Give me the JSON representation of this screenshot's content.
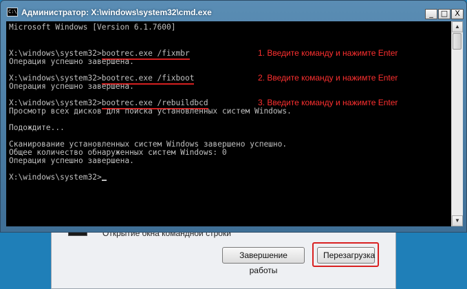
{
  "window": {
    "title": "Администратор: X:\\windows\\system32\\cmd.exe",
    "icon_label": "C:\\",
    "minimize_glyph": "_",
    "maximize_glyph": "□",
    "close_glyph": "X"
  },
  "console": {
    "header": "Microsoft Windows [Version 6.1.7600]",
    "prompt": "X:\\windows\\system32>",
    "commands": [
      {
        "command": "bootrec.exe /fixmbr",
        "annotation": "1. Введите команду и нажимте Enter",
        "output": [
          "Операция успешно завершена."
        ]
      },
      {
        "command": "bootrec.exe /fixboot",
        "annotation": "2. Введите команду и нажимте Enter",
        "output": [
          "Операция успешно завершена."
        ]
      },
      {
        "command": "bootrec.exe /rebuildbcd",
        "annotation": "3. Введите команду и нажимте Enter",
        "output": [
          "Просмотр всех дисков для поиска установленных систем Windows.",
          "",
          "Подождите...",
          "",
          "Сканирование установленных систем Windows завершено успешно.",
          "Общее количество обнаруженных систем Windows: 0",
          "Операция успешно завершена."
        ]
      }
    ],
    "final_prompt": "X:\\windows\\system32>"
  },
  "background_dialog": {
    "item_text": "Открытие окна командной строки",
    "shutdown_label": "Завершение работы",
    "restart_label": "Перезагрузка"
  },
  "colors": {
    "annotation": "#ff3030",
    "highlight": "#d92020",
    "console_bg": "#000000",
    "console_text": "#c0c0c0"
  }
}
